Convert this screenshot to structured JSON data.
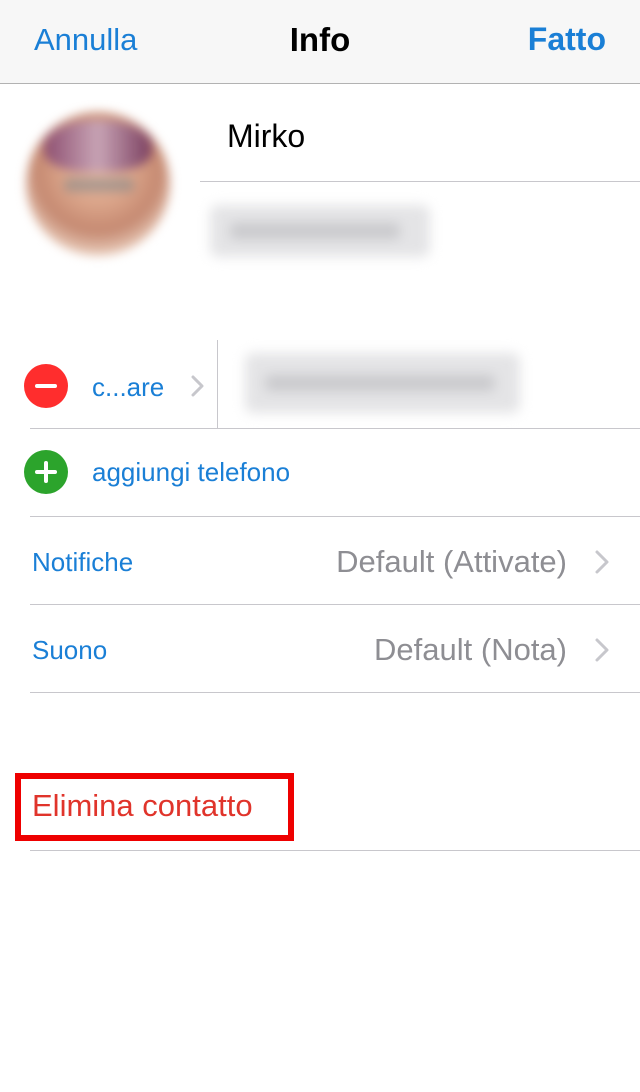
{
  "navbar": {
    "cancel_label": "Annulla",
    "title": "Info",
    "done_label": "Fatto"
  },
  "contact": {
    "first_name": "Mirko"
  },
  "phone": {
    "label": "c...are"
  },
  "add_phone": {
    "label": "aggiungi telefono"
  },
  "settings": [
    {
      "label": "Notifiche",
      "value": "Default (Attivate)"
    },
    {
      "label": "Suono",
      "value": "Default (Nota)"
    }
  ],
  "delete": {
    "label": "Elimina contatto"
  },
  "colors": {
    "accent": "#1a7fd6",
    "delete_red": "#e0342b",
    "highlight_box": "#ee0000",
    "minus_red": "#ff2d2d",
    "plus_green": "#2ca42c"
  }
}
